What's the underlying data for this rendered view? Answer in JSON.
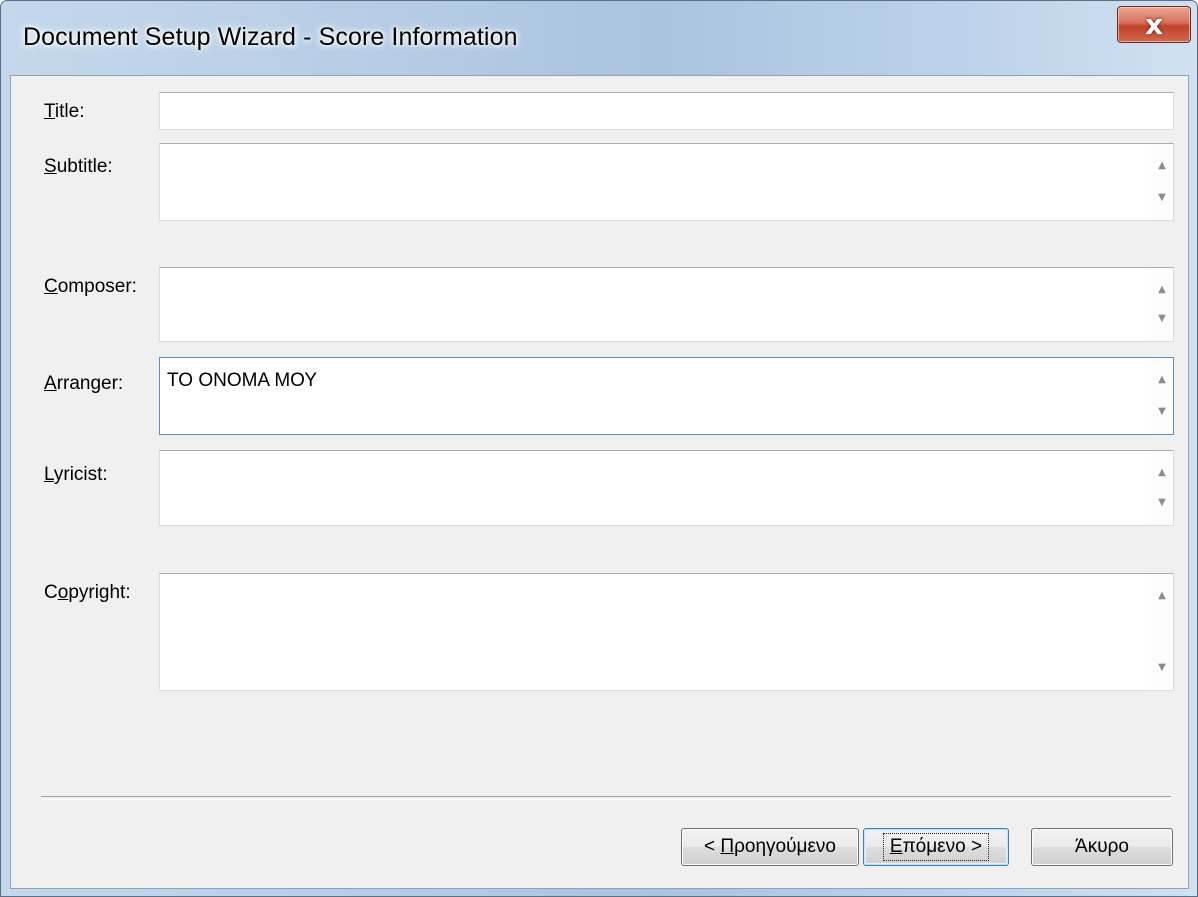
{
  "window": {
    "title": "Document Setup Wizard - Score Information",
    "close_glyph": "x",
    "accent_colors": {
      "close_button": "#c7442d",
      "focus_border": "#5c8fc6",
      "frame": "#b9cfe6"
    }
  },
  "form": {
    "fields": [
      {
        "name": "title",
        "label_access": "T",
        "label_rest": "itle:",
        "value": ""
      },
      {
        "name": "subtitle",
        "label_access": "S",
        "label_rest": "ubtitle:",
        "value": ""
      },
      {
        "name": "composer",
        "label_access": "C",
        "label_rest": "omposer:",
        "value": ""
      },
      {
        "name": "arranger",
        "label_access": "A",
        "label_rest": "rranger:",
        "value": "ΤΟ ΟΝΟΜΑ ΜΟΥ"
      },
      {
        "name": "lyricist",
        "label_access": "L",
        "label_rest": "yricist:",
        "value": ""
      },
      {
        "name": "copyright",
        "label_pre": "C",
        "label_access": "o",
        "label_rest": "pyright:",
        "value": ""
      }
    ]
  },
  "buttons": {
    "back": {
      "prefix": "< ",
      "access": "Π",
      "rest": "ροηγούμενο"
    },
    "next": {
      "access": "Ε",
      "rest": "πόμενο >"
    },
    "cancel": {
      "label": "Άκυρο"
    }
  }
}
